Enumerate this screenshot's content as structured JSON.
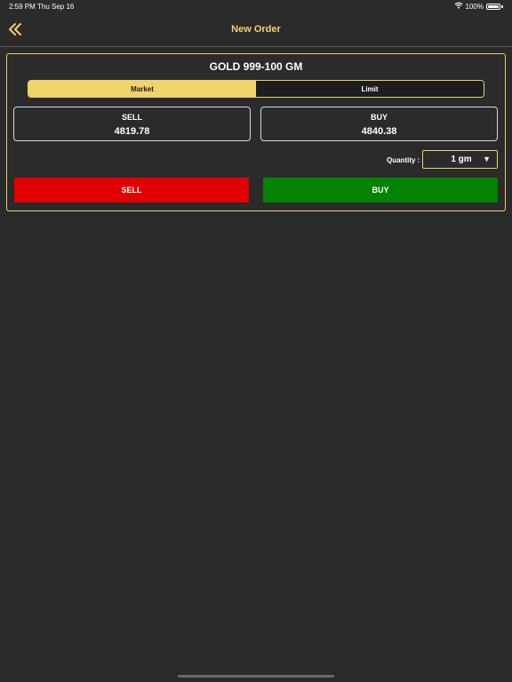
{
  "status_bar": {
    "time": "2:59 PM",
    "date": "Thu Sep 16",
    "battery": "100%",
    "icons": [
      "wifi-icon",
      "battery-icon"
    ]
  },
  "nav": {
    "title": "New Order",
    "back_icon": "double-chevron-left-icon"
  },
  "order": {
    "product": "GOLD 999-100 GM",
    "tabs": [
      {
        "label": "Market",
        "active": true
      },
      {
        "label": "Limit",
        "active": false
      }
    ],
    "sell_price": {
      "label": "SELL",
      "value": "4819.78"
    },
    "buy_price": {
      "label": "BUY",
      "value": "4840.38"
    },
    "quantity": {
      "label": "Quantity :",
      "value": "1 gm"
    },
    "sell_button": "SELL",
    "buy_button": "BUY"
  },
  "colors": {
    "background": "#2b2b2b",
    "accent": "#f0d36b",
    "sell": "#e00000",
    "buy": "#038203"
  }
}
